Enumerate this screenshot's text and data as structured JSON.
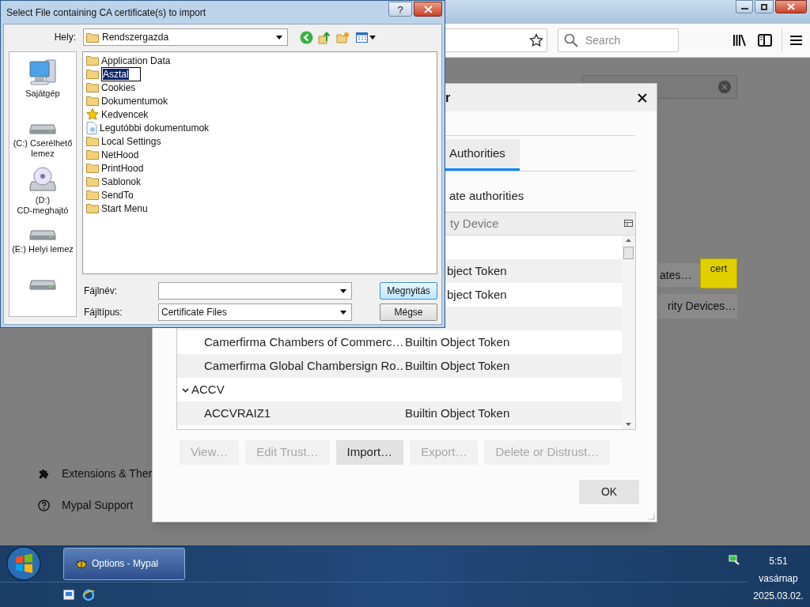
{
  "browser": {
    "window_buttons": [
      {
        "kind": "minimize"
      },
      {
        "kind": "maximize"
      },
      {
        "kind": "close"
      }
    ],
    "search_placeholder": "Search",
    "nav": [
      {
        "label": "Extensions & Ther",
        "kind": "extensions"
      },
      {
        "label": "Mypal Support",
        "kind": "support"
      }
    ],
    "side_buttons": [
      "ates…",
      "rity Devices…"
    ],
    "tooltip": "cert"
  },
  "cert_dialog": {
    "title": "r",
    "tab": {
      "label": "Authorities",
      "selected": true
    },
    "intro": "ate authorities",
    "column": "ty Device",
    "rows": [
      {
        "kind": "cut"
      },
      {
        "kind": "cut",
        "token": "bject Token"
      },
      {
        "kind": "cut",
        "token": "bject Token"
      },
      {
        "kind": "cut"
      },
      {
        "kind": "cert",
        "name": "Camerfirma Chambers of Commerc…",
        "token": "Builtin Object Token"
      },
      {
        "kind": "cert",
        "name": "Camerfirma Global Chambersign Ro…",
        "token": "Builtin Object Token"
      },
      {
        "kind": "group",
        "name": "ACCV",
        "expanded": true
      },
      {
        "kind": "cert",
        "name": "ACCVRAIZ1",
        "token": "Builtin Object Token"
      }
    ],
    "buttons": [
      {
        "label": "View…",
        "disabled": true
      },
      {
        "label": "Edit Trust…",
        "disabled": true
      },
      {
        "label": "Import…",
        "disabled": false
      },
      {
        "label": "Export…",
        "disabled": true
      },
      {
        "label": "Delete or Distrust…",
        "disabled": true
      }
    ],
    "ok": "OK"
  },
  "file_dialog": {
    "title": "Select File containing CA certificate(s) to import",
    "help": "?",
    "location_label": "Hely:",
    "location": "Rendszergazda",
    "places": [
      {
        "label": "Sajátgép",
        "kind": "computer"
      },
      {
        "label": "(C:) Cserélhető lemez",
        "kind": "drive"
      },
      {
        "label": "(D:) CD-meghajtó",
        "kind": "cd"
      },
      {
        "label": "(E:) Helyi lemez",
        "kind": "drive"
      },
      {
        "kind": "drive"
      }
    ],
    "files": [
      {
        "name": "Application Data",
        "kind": "folder",
        "selected": false
      },
      {
        "name": "Asztal",
        "kind": "folder",
        "selected": true
      },
      {
        "name": "Cookies",
        "kind": "folder",
        "selected": false
      },
      {
        "name": "Dokumentumok",
        "kind": "folder",
        "selected": false
      },
      {
        "name": "Kedvencek",
        "kind": "favorites",
        "selected": false
      },
      {
        "name": "Legutóbbi dokumentumok",
        "kind": "recent",
        "selected": false
      },
      {
        "name": "Local Settings",
        "kind": "folder",
        "selected": false
      },
      {
        "name": "NetHood",
        "kind": "folder",
        "selected": false
      },
      {
        "name": "PrintHood",
        "kind": "folder",
        "selected": false
      },
      {
        "name": "Sablonok",
        "kind": "folder",
        "selected": false
      },
      {
        "name": "SendTo",
        "kind": "folder",
        "selected": false
      },
      {
        "name": "Start Menu",
        "kind": "folder",
        "selected": false
      }
    ],
    "filename_label": "Fájlnév:",
    "filetype_label": "Fájltípus:",
    "filetype": "Certificate Files",
    "open_button": "Megnyitás",
    "cancel_button": "Mégse"
  },
  "taskbar": {
    "task": {
      "label": "Options - Mypal",
      "selected": true
    },
    "time": "5:51",
    "day": "vasárnap",
    "date": "2025.03.02."
  }
}
